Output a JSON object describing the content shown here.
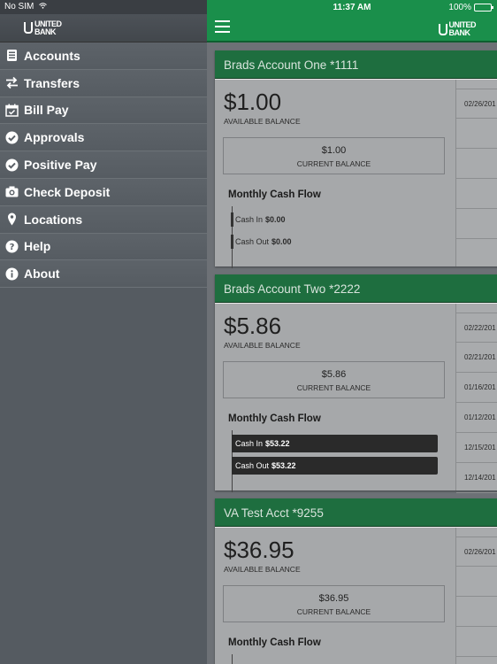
{
  "status": {
    "carrier": "No SIM",
    "time": "11:37 AM",
    "battery": "100%"
  },
  "brand": {
    "line1": "UNITED",
    "line2": "BANK"
  },
  "sidebar": {
    "items": [
      {
        "label": "Accounts",
        "icon": "accounts-icon"
      },
      {
        "label": "Transfers",
        "icon": "transfers-icon"
      },
      {
        "label": "Bill Pay",
        "icon": "calendar-icon"
      },
      {
        "label": "Approvals",
        "icon": "check-circle-icon"
      },
      {
        "label": "Positive Pay",
        "icon": "check-circle-icon"
      },
      {
        "label": "Check Deposit",
        "icon": "camera-icon"
      },
      {
        "label": "Locations",
        "icon": "location-pin-icon"
      },
      {
        "label": "Help",
        "icon": "help-icon"
      },
      {
        "label": "About",
        "icon": "info-icon"
      }
    ]
  },
  "accounts": [
    {
      "name": "Brads Account One *1111",
      "available": "$1.00",
      "available_label": "AVAILABLE BALANCE",
      "current": "$1.00",
      "current_label": "CURRENT BALANCE",
      "cash_flow_title": "Monthly Cash Flow",
      "cash_in_label": "Cash In",
      "cash_in": "$0.00",
      "cash_out_label": "Cash Out",
      "cash_out": "$0.00",
      "dates": [
        "02/26/201",
        "",
        "",
        "",
        ""
      ]
    },
    {
      "name": "Brads Account Two *2222",
      "available": "$5.86",
      "available_label": "AVAILABLE BALANCE",
      "current": "$5.86",
      "current_label": "CURRENT BALANCE",
      "cash_flow_title": "Monthly Cash Flow",
      "cash_in_label": "Cash In",
      "cash_in": "$53.22",
      "cash_out_label": "Cash Out",
      "cash_out": "$53.22",
      "dates": [
        "02/22/201",
        "02/21/201",
        "01/16/201",
        "01/12/201",
        "12/15/201",
        "12/14/201"
      ]
    },
    {
      "name": "VA Test Acct *9255",
      "available": "$36.95",
      "available_label": "AVAILABLE BALANCE",
      "current": "$36.95",
      "current_label": "CURRENT BALANCE",
      "cash_flow_title": "Monthly Cash Flow",
      "dates": [
        "02/26/201",
        "",
        "",
        ""
      ]
    }
  ]
}
